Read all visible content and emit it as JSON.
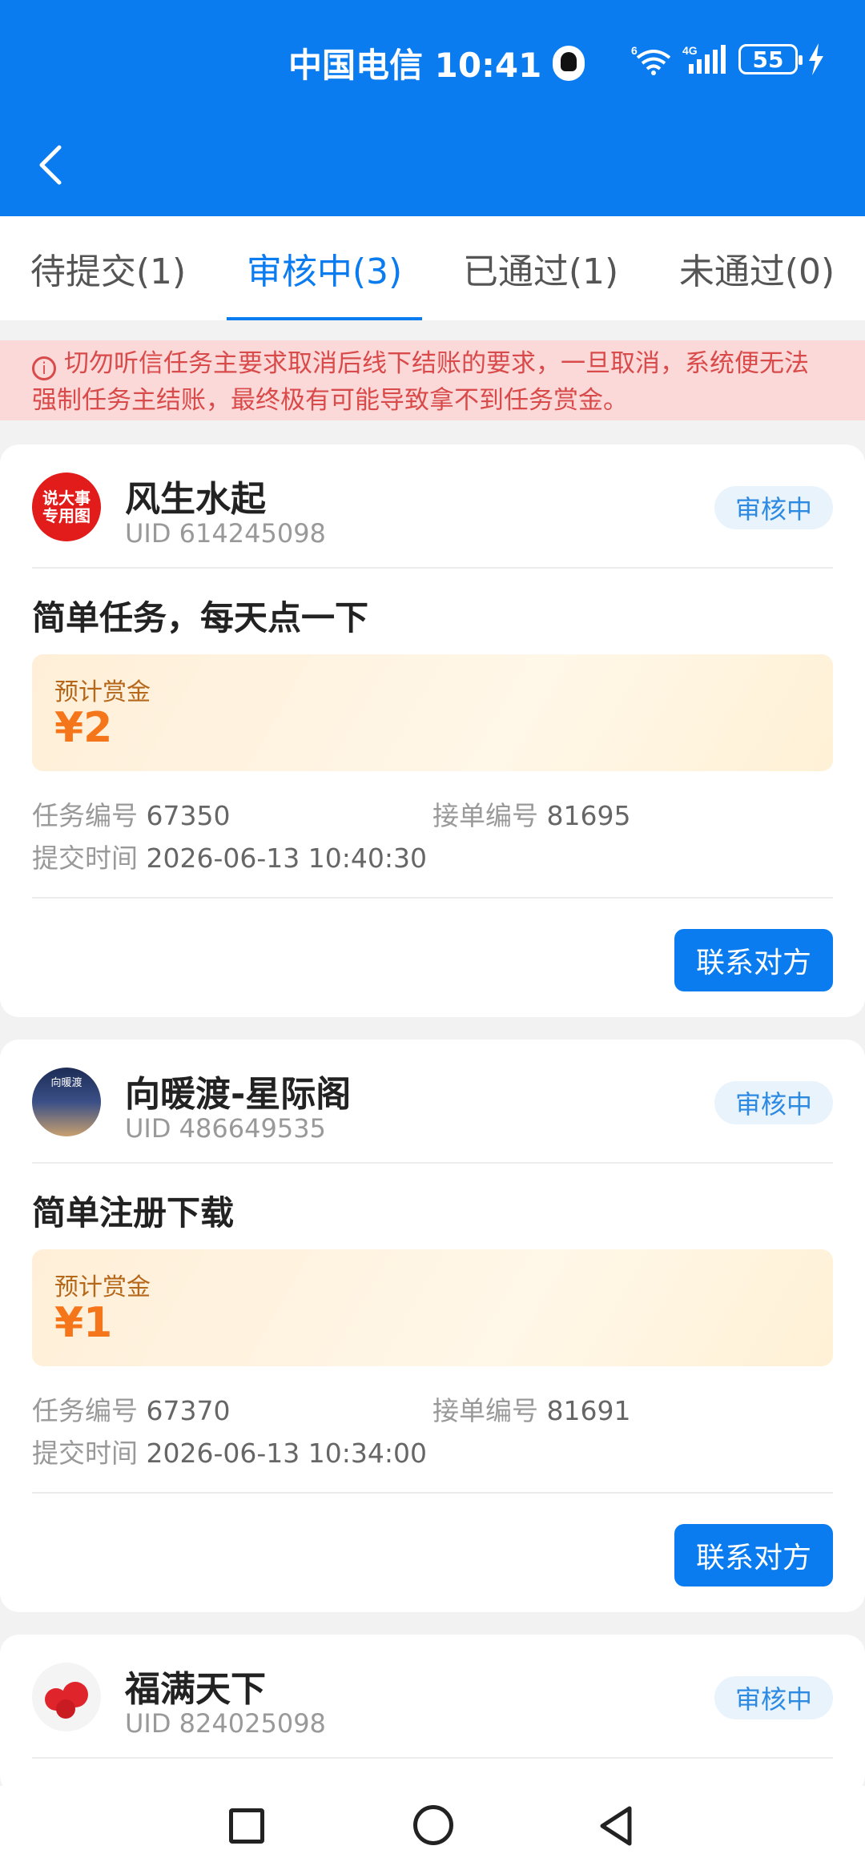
{
  "status_bar": {
    "carrier_time": "中国电信 10:41",
    "network": "4G",
    "wifi_label": "6",
    "battery": "55",
    "icons": [
      "qq-icon",
      "wifi-icon",
      "signal-icon",
      "battery-icon",
      "charging-bolt-icon"
    ]
  },
  "header": {
    "back_icon": "chevron-left-icon",
    "color": "#0a7cf0"
  },
  "tabs": [
    {
      "label": "待提交(1)",
      "active": false
    },
    {
      "label": "审核中(3)",
      "active": true
    },
    {
      "label": "已通过(1)",
      "active": false
    },
    {
      "label": "未通过(0)",
      "active": false
    }
  ],
  "notice": {
    "text": "切勿听信任务主要求取消后线下结账的要求，一旦取消，系统便无法强制任务主结账，最终极有可能导致拿不到任务赏金。",
    "icon": "info-icon"
  },
  "labels": {
    "reward": "预计赏金",
    "task_no": "任务编号",
    "order_no": "接单编号",
    "submit_time": "提交时间",
    "contact": "联系对方"
  },
  "cards": [
    {
      "name": "风生水起",
      "uid": "UID 614245098",
      "status": "审核中",
      "avatar_text": "说大事\n专用图",
      "title": "简单任务，每天点一下",
      "reward": "¥2",
      "task_no": "67350",
      "order_no": "81695",
      "submit_time": "2026-06-13 10:40:30"
    },
    {
      "name": "向暖渡-星际阁",
      "uid": "UID 486649535",
      "status": "审核中",
      "avatar_text": "向暖渡",
      "title": "简单注册下载",
      "reward": "¥1",
      "task_no": "67370",
      "order_no": "81691",
      "submit_time": "2026-06-13 10:34:00"
    },
    {
      "name": "福满天下",
      "uid": "UID 824025098",
      "status": "审核中"
    }
  ],
  "colors": {
    "primary": "#0a7cf0",
    "reward": "#f5761a",
    "notice_bg": "#fbd9d9",
    "notice_text": "#d94a4a"
  }
}
